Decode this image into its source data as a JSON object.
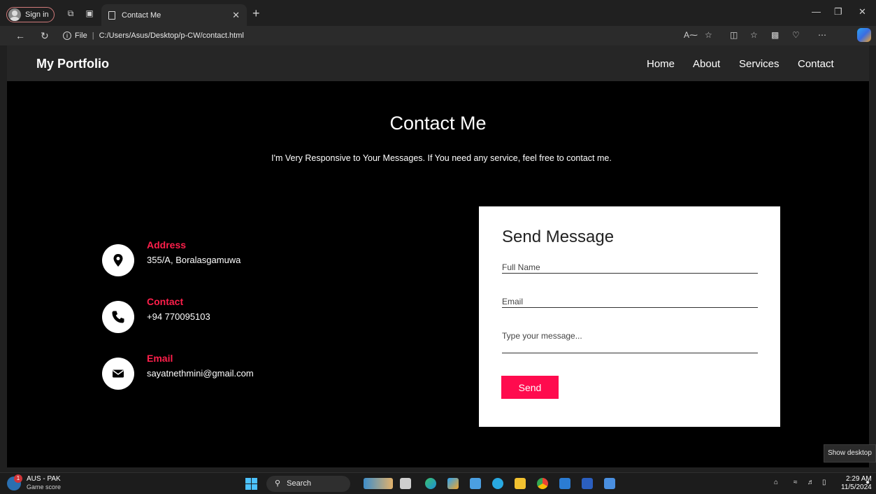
{
  "browser": {
    "signin_label": "Sign in",
    "tab_title": "Contact Me",
    "url_label": "File",
    "url_path": "C:/Users/Asus/Desktop/p-CW/contact.html"
  },
  "site": {
    "brand": "My Portfolio",
    "nav": [
      "Home",
      "About",
      "Services",
      "Contact"
    ]
  },
  "page": {
    "heading": "Contact Me",
    "subtitle": "I'm Very Responsive to Your Messages. If You need any service, feel free to contact me."
  },
  "contact_info": [
    {
      "icon": "map-pin-icon",
      "title": "Address",
      "value": "355/A, Boralasgamuwa"
    },
    {
      "icon": "phone-icon",
      "title": "Contact",
      "value": "+94 770095103"
    },
    {
      "icon": "envelope-icon",
      "title": "Email",
      "value": "sayatnethmini@gmail.com"
    }
  ],
  "form": {
    "heading": "Send Message",
    "name_placeholder": "Full Name",
    "email_placeholder": "Email",
    "message_placeholder": "Type your message...",
    "send_label": "Send"
  },
  "tooltip": "Show desktop",
  "taskbar": {
    "weather_title": "AUS - PAK",
    "weather_sub": "Game score",
    "badge": "1",
    "search_label": "Search",
    "time": "2:29 AM",
    "date": "11/5/2024"
  },
  "colors": {
    "accent": "#ff1f4b",
    "button": "#ff0b4e",
    "navbar": "#262626",
    "page_bg": "#000000"
  }
}
